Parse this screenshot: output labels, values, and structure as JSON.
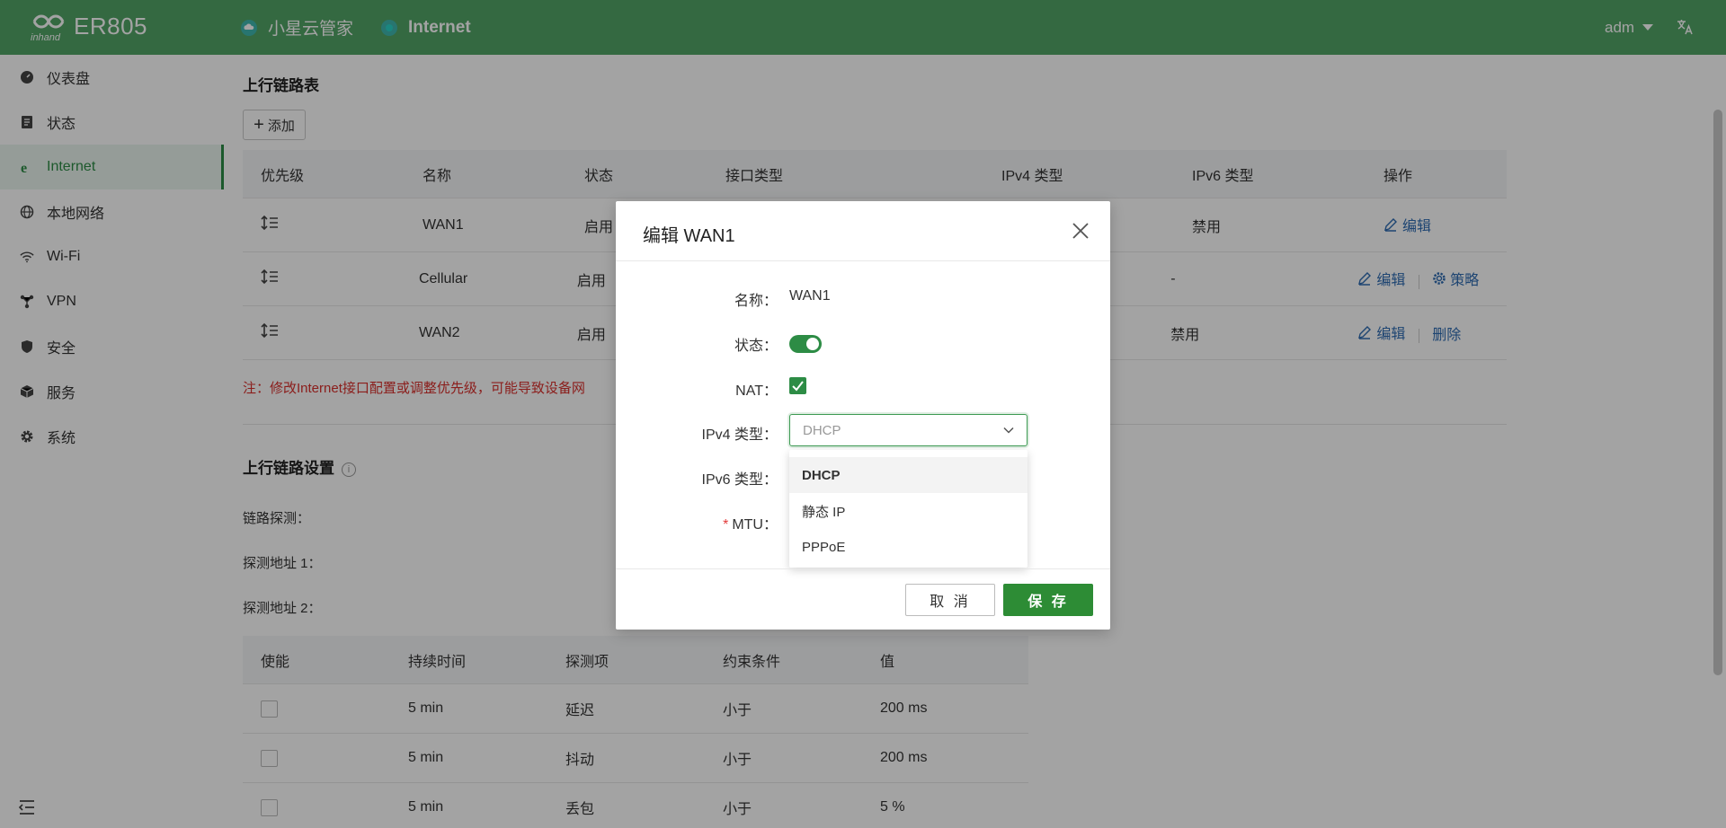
{
  "header": {
    "title": "ER805",
    "nav_cloud": "小星云管家",
    "nav_internet": "Internet",
    "user": "adm",
    "colors": {
      "header_bg": "#52a467",
      "accent": "#2d8c45"
    }
  },
  "sidebar": {
    "items": [
      {
        "label": "仪表盘",
        "icon": "dashboard-icon"
      },
      {
        "label": "状态",
        "icon": "document-icon"
      },
      {
        "label": "Internet",
        "icon": "internet-icon"
      },
      {
        "label": "本地网络",
        "icon": "globe-icon"
      },
      {
        "label": "Wi-Fi",
        "icon": "wifi-icon"
      },
      {
        "label": "VPN",
        "icon": "vpn-icon"
      },
      {
        "label": "安全",
        "icon": "shield-icon"
      },
      {
        "label": "服务",
        "icon": "box-icon"
      },
      {
        "label": "系统",
        "icon": "gear-icon"
      }
    ]
  },
  "uplink_table": {
    "title": "上行链路表",
    "add_label": "添加",
    "columns": [
      "优先级",
      "名称",
      "状态",
      "接口类型",
      "IPv4 类型",
      "IPv6 类型",
      "操作"
    ],
    "rows": [
      {
        "name": "WAN1",
        "status": "启用",
        "ipv6": "禁用",
        "actions": [
          "编辑"
        ]
      },
      {
        "name": "Cellular",
        "status": "启用",
        "ipv6": "-",
        "actions": [
          "编辑",
          "策略"
        ]
      },
      {
        "name": "WAN2",
        "status": "启用",
        "ipv6": "禁用",
        "actions": [
          "编辑",
          "删除"
        ]
      }
    ],
    "note": "注：修改Internet接口配置或调整优先级，可能导致设备网"
  },
  "uplink_settings": {
    "title": "上行链路设置",
    "link_detect_label": "链路探测：",
    "addr1_label": "探测地址 1：",
    "addr2_label": "探测地址 2："
  },
  "detect_table": {
    "columns": [
      "使能",
      "持续时间",
      "探测项",
      "约束条件",
      "值"
    ],
    "rows": [
      {
        "duration": "5 min",
        "item": "延迟",
        "cond": "小于",
        "value": "200 ms"
      },
      {
        "duration": "5 min",
        "item": "抖动",
        "cond": "小于",
        "value": "200 ms"
      },
      {
        "duration": "5 min",
        "item": "丢包",
        "cond": "小于",
        "value": "5 %"
      }
    ]
  },
  "modal": {
    "title": "编辑 WAN1",
    "name_label": "名称：",
    "name_value": "WAN1",
    "status_label": "状态：",
    "nat_label": "NAT：",
    "ipv4_label": "IPv4 类型：",
    "ipv4_value": "DHCP",
    "ipv6_label": "IPv6 类型：",
    "mtu_req": "*",
    "mtu_label": "MTU：",
    "dropdown_options": [
      "DHCP",
      "静态 IP",
      "PPPoE"
    ],
    "cancel_label": "取 消",
    "save_label": "保 存"
  }
}
